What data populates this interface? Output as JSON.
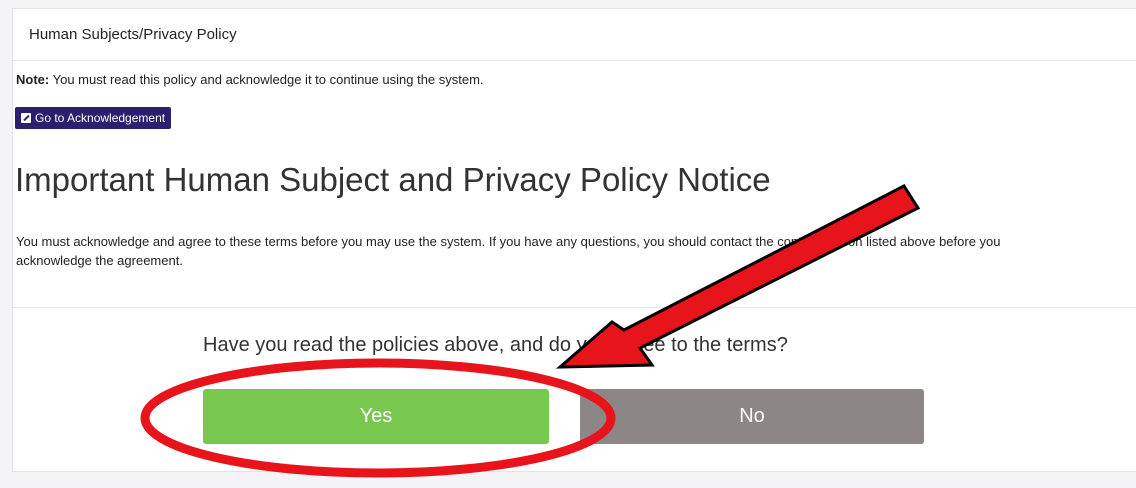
{
  "card": {
    "header_title": "Human Subjects/Privacy Policy"
  },
  "note": {
    "label": "Note:",
    "text": "You must read this policy and acknowledge it to continue using the system."
  },
  "acknowledge_button": {
    "label": "Go to Acknowledgement",
    "icon": "edit-icon"
  },
  "notice": {
    "heading": "Important Human Subject and Privacy Policy Notice",
    "body": "You must acknowledge and agree to these terms before you may use the system. If you have any questions, you should contact the contact person listed above before you acknowledge the agreement."
  },
  "agreement": {
    "question": "Have you read the policies above, and do you agree to the terms?",
    "yes_label": "Yes",
    "no_label": "No"
  },
  "colors": {
    "yes_button": "#78c850",
    "no_button": "#8c8786",
    "acknowledge_button": "#2b1f6e",
    "annotation": "#e8141b"
  }
}
